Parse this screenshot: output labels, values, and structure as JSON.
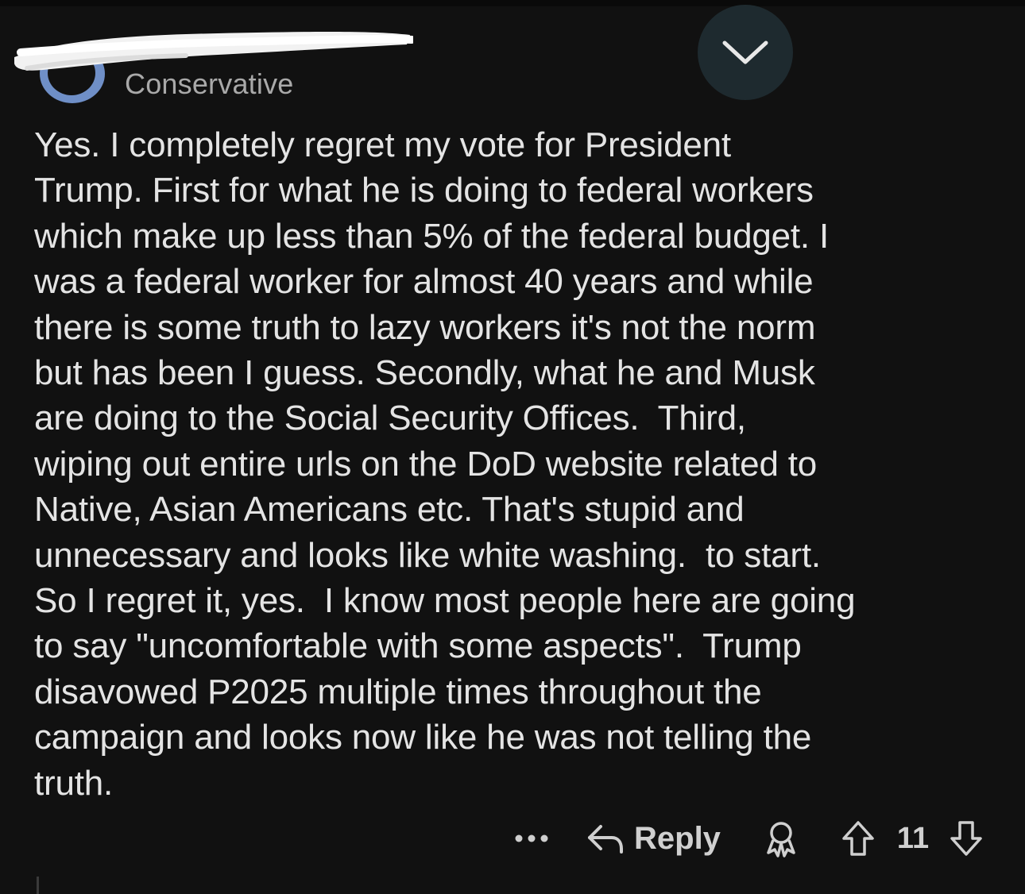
{
  "comment": {
    "author_flair": "Conservative",
    "body": "Yes. I completely regret my vote for President\nTrump. First for what he is doing to federal workers\nwhich make up less than 5% of the federal budget. I\nwas a federal worker for almost 40 years and while\nthere is some truth to lazy workers it's not the norm\nbut has been I guess. Secondly, what he and Musk\nare doing to the Social Security Offices.  Third,\nwiping out entire urls on the DoD website related to\nNative, Asian Americans etc. That's stupid and\nunnecessary and looks like white washing.  to start.\nSo I regret it, yes.  I know most people here are going\nto say \"uncomfortable with some aspects\".  Trump\ndisavowed P2025 multiple times throughout the\ncampaign and looks now like he was not telling the\ntruth."
  },
  "actions": {
    "more_label": "•••",
    "reply_label": "Reply",
    "score": "11"
  },
  "icons": {
    "collapse": "chevron-down-icon",
    "more": "more-dots-icon",
    "reply": "reply-arrow-icon",
    "award": "award-icon",
    "upvote": "upvote-arrow-icon",
    "downvote": "downvote-arrow-icon"
  },
  "colors": {
    "background": "#111111",
    "text": "#e4e4e4",
    "muted": "#a9a9a9",
    "avatar_ring": "#6f8fc7",
    "collapse_bg": "#1e2a2f"
  }
}
